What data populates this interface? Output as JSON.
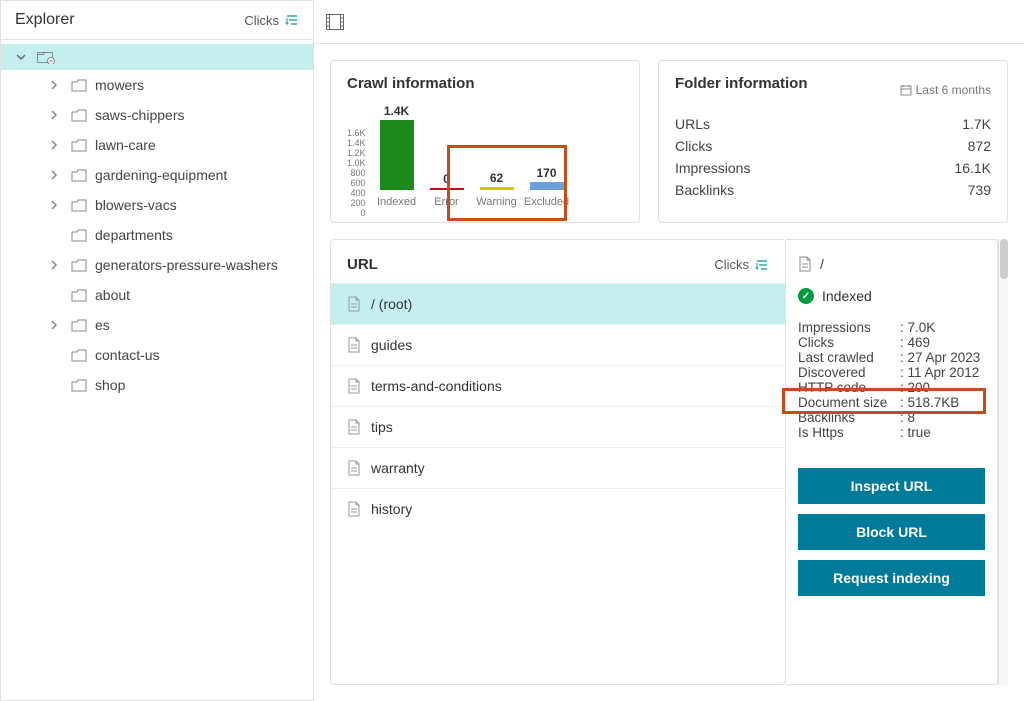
{
  "sidebar": {
    "title": "Explorer",
    "sort_label": "Clicks",
    "items": [
      {
        "label": "mowers",
        "chev": true
      },
      {
        "label": "saws-chippers",
        "chev": true
      },
      {
        "label": "lawn-care",
        "chev": true
      },
      {
        "label": "gardening-equipment",
        "chev": true
      },
      {
        "label": "blowers-vacs",
        "chev": true
      },
      {
        "label": "departments",
        "chev": false
      },
      {
        "label": "generators-pressure-washers",
        "chev": true
      },
      {
        "label": "about",
        "chev": false
      },
      {
        "label": "es",
        "chev": true
      },
      {
        "label": "contact-us",
        "chev": false
      },
      {
        "label": "shop",
        "chev": false
      }
    ]
  },
  "crawl": {
    "title": "Crawl information"
  },
  "chart_data": {
    "type": "bar",
    "categories": [
      "Indexed",
      "Error",
      "Warning",
      "Excluded"
    ],
    "values": [
      1400,
      0,
      62,
      170
    ],
    "value_labels": [
      "1.4K",
      "0",
      "62",
      "170"
    ],
    "colors": [
      "#1b8a1b",
      "#d0021b",
      "#f5b700",
      "#6ca0dc"
    ],
    "ylim": [
      0,
      1600
    ],
    "y_ticks": [
      "1.6K",
      "1.4K",
      "1.2K",
      "1.0K",
      "800",
      "600",
      "400",
      "200",
      "0"
    ],
    "title": "Crawl information"
  },
  "folder": {
    "title": "Folder information",
    "date_range": "Last 6 months",
    "stats": [
      {
        "k": "URLs",
        "v": "1.7K"
      },
      {
        "k": "Clicks",
        "v": "872"
      },
      {
        "k": "Impressions",
        "v": "16.1K"
      },
      {
        "k": "Backlinks",
        "v": "739"
      }
    ]
  },
  "urls": {
    "title": "URL",
    "sort_label": "Clicks",
    "items": [
      {
        "label": "/ (root)",
        "selected": true
      },
      {
        "label": "guides"
      },
      {
        "label": "terms-and-conditions"
      },
      {
        "label": "tips"
      },
      {
        "label": "warranty"
      },
      {
        "label": "history"
      }
    ]
  },
  "detail": {
    "url": "/",
    "status": "Indexed",
    "stats": [
      {
        "k": "Impressions",
        "v": "7.0K"
      },
      {
        "k": "Clicks",
        "v": "469"
      },
      {
        "k": "Last crawled",
        "v": "27 Apr 2023"
      },
      {
        "k": "Discovered",
        "v": "11 Apr 2012"
      },
      {
        "k": "HTTP code",
        "v": "200"
      },
      {
        "k": "Document size",
        "v": "518.7KB"
      },
      {
        "k": "Backlinks",
        "v": "8"
      },
      {
        "k": "Is Https",
        "v": "true"
      }
    ],
    "actions": [
      "Inspect URL",
      "Block URL",
      "Request indexing"
    ]
  }
}
